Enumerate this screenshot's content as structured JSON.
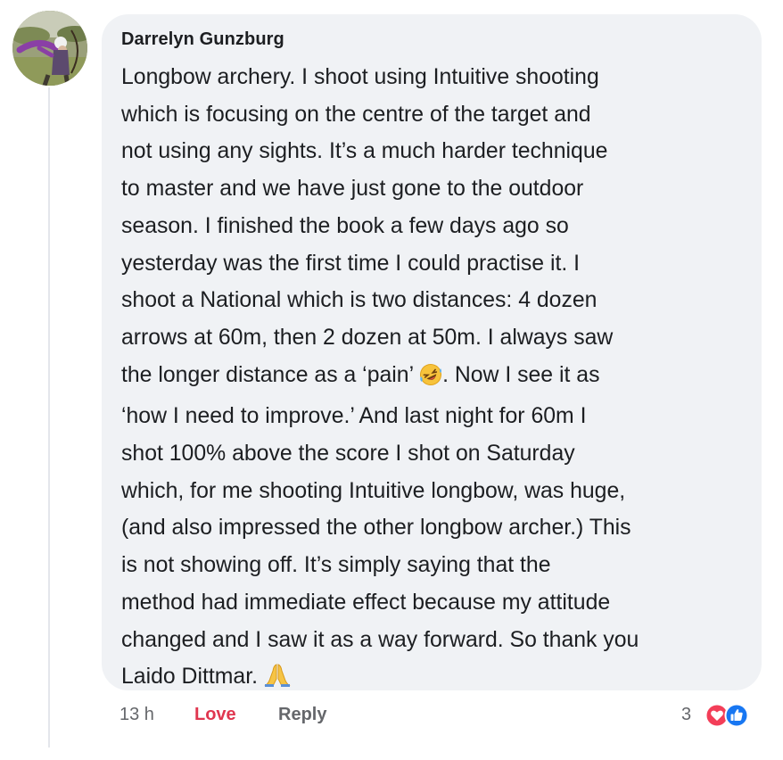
{
  "comment": {
    "author": "Darrelyn Gunzburg",
    "lines": [
      "Longbow archery. I shoot using Intuitive shooting",
      "which is focusing on the centre of the target and",
      "not using any sights. It’s a much harder technique",
      "to master and we have just gone to the outdoor",
      "season. I finished the book a few days ago so",
      "yesterday was the first time I could practise it. I",
      "shoot a National which is two distances: 4 dozen",
      "arrows at 60m, then 2 dozen at 50m. I always saw",
      "the longer distance as a ‘pain’",
      ". Now I see it as",
      "‘how I need to improve.’ And last night for 60m I",
      "shot 100% above the score I shot on Saturday",
      "which, for me shooting Intuitive longbow, was huge,",
      "(and also impressed the other longbow archer.) This",
      "is not showing off. It’s simply saying that the",
      "method had immediate effect because my attitude",
      "changed and I saw it as a way forward. So thank you",
      "Laido Dittmar."
    ],
    "emojis": {
      "laughing": "rolling-on-floor-laughing-icon",
      "prayer": "folded-hands-icon"
    }
  },
  "actions": {
    "timestamp": "13 h",
    "love_label": "Love",
    "reply_label": "Reply"
  },
  "reactions": {
    "count": "3",
    "types": [
      "heart-icon",
      "like-icon"
    ]
  },
  "colors": {
    "bubble": "#f0f2f5",
    "love": "#e0364f",
    "heart": "#f33e58",
    "like": "#1877f2",
    "meta": "#65676b",
    "text": "#1c1e21"
  }
}
